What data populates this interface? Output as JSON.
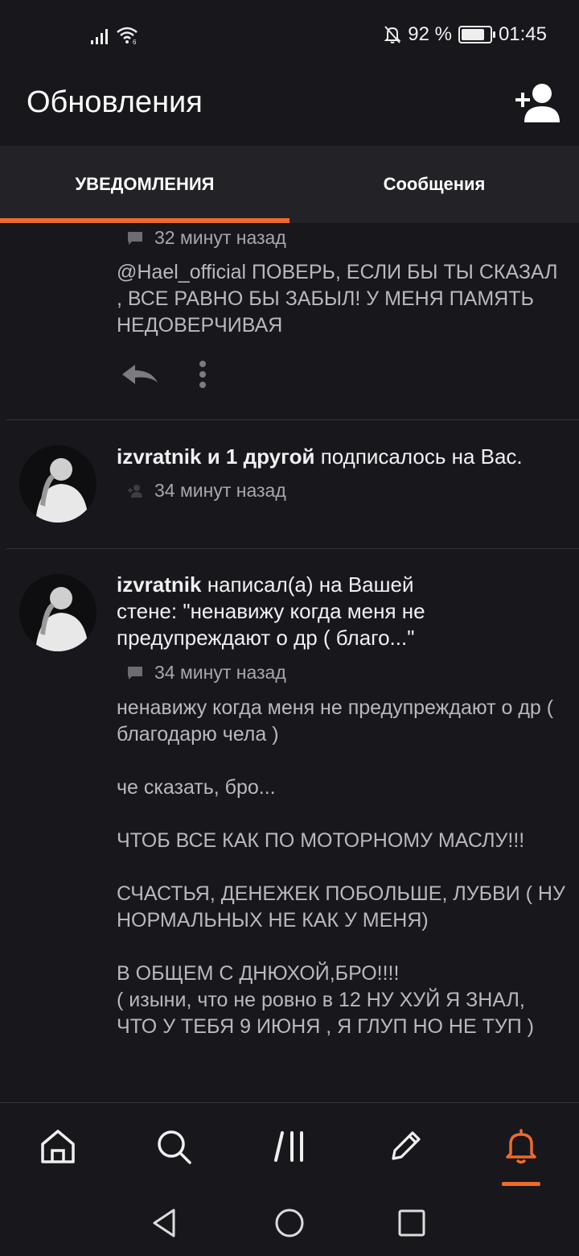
{
  "status_bar": {
    "battery_percent": "92 %",
    "battery_level": 0.92,
    "time": "01:45",
    "icons": [
      "signal-icon",
      "wifi-icon",
      "bell-off-icon",
      "battery-icon"
    ]
  },
  "header": {
    "title": "Обновления",
    "add_user_icon": "add-user-icon"
  },
  "tabs": [
    {
      "label": "УВЕДОМЛЕНИЯ",
      "active": true
    },
    {
      "label": "Сообщения",
      "active": false
    }
  ],
  "accent_color": "#ee6a2c",
  "feed": {
    "item1": {
      "time": "32 минут назад",
      "text": "@Hael_official  ПОВЕРЬ, ЕСЛИ БЫ ТЫ СКАЗАЛ , ВСЕ РАВНО БЫ ЗАБЫЛ!  У МЕНЯ ПАМЯТЬ НЕДОВЕРЧИВАЯ"
    },
    "item2": {
      "user": "izvratnik и 1 другой",
      "action": " подписалось на Вас.",
      "time": "34 минут назад"
    },
    "item3": {
      "user": "izvratnik",
      "action": " написал(а) на Вашей стене: \"ненавижу когда меня не предупреждают о др ( благо...\"",
      "time": "34 минут назад",
      "text": "ненавижу когда меня не предупреждают о др ( благодарю чела )\n\nче сказать, бро...\n\nЧТОБ ВСЕ КАК ПО МОТОРНОМУ МАСЛУ!!!\n\nСЧАСТЬЯ, ДЕНЕЖЕК ПОБОЛЬШЕ, ЛУБВИ ( НУ НОРМАЛЬНЫХ НЕ КАК У МЕНЯ)\n\nВ ОБЩЕМ С ДНЮХОЙ,БРО!!!!\n( изыни, что не ровно в 12 НУ ХУЙ Я ЗНАЛ, ЧТО У ТЕБЯ 9 ИЮНЯ , Я ГЛУП НО НЕ ТУП )"
    }
  },
  "bottom_nav": [
    "home-icon",
    "search-icon",
    "feed-icon",
    "edit-icon",
    "bell-icon"
  ]
}
